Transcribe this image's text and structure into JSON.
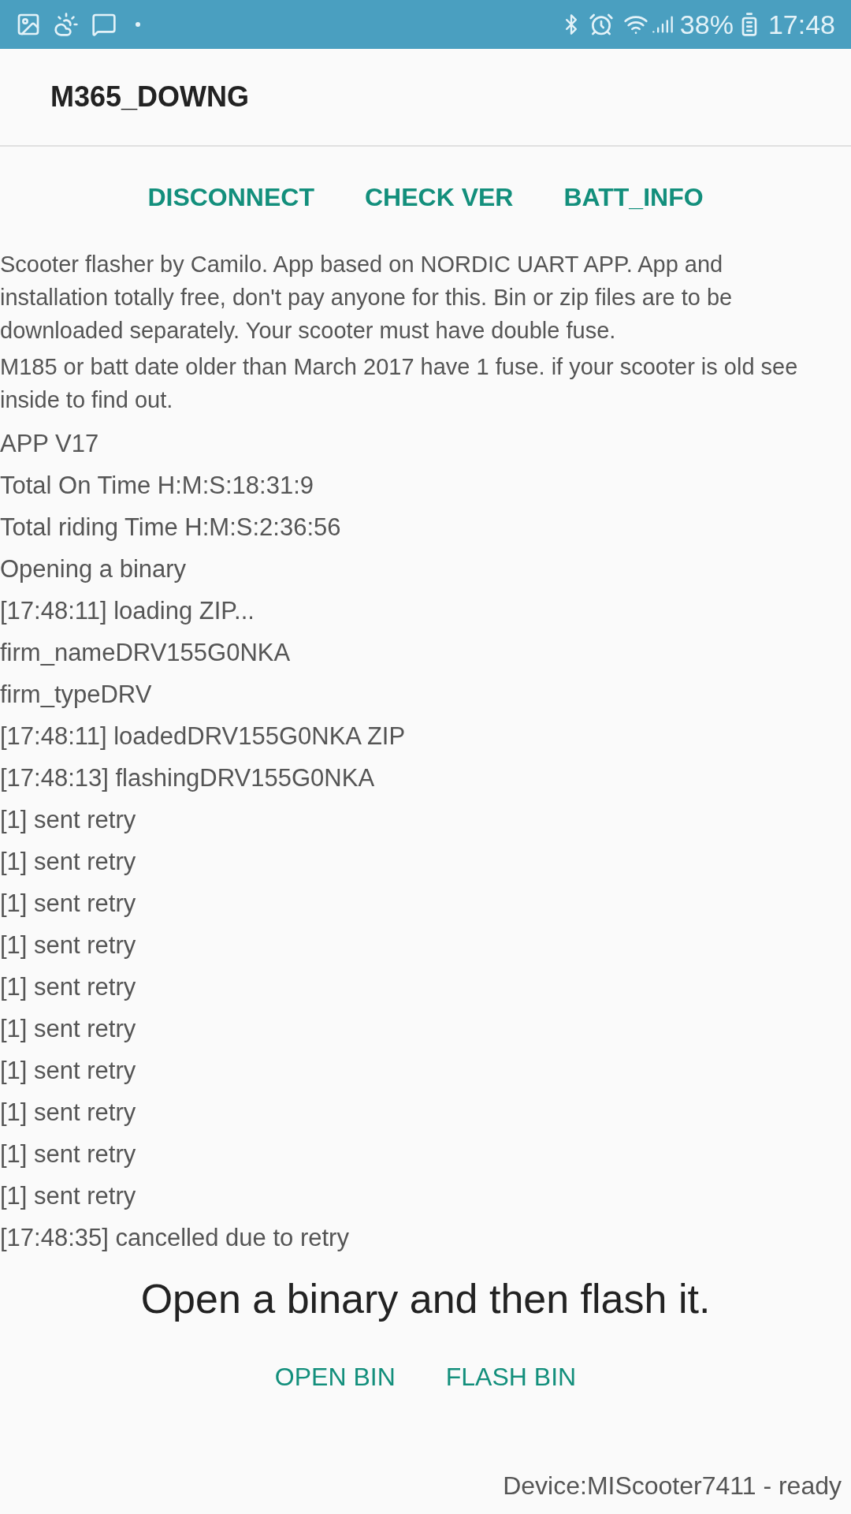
{
  "status_bar": {
    "battery": "38%",
    "time": "17:48"
  },
  "app_bar": {
    "title": "M365_DOWNG"
  },
  "top_buttons": [
    "DISCONNECT",
    "CHECK VER",
    "BATT_INFO"
  ],
  "info": [
    "Scooter flasher by Camilo. App based on NORDIC UART APP. App and installation totally free, don't pay anyone for this. Bin or zip files are to be downloaded separately. Your scooter must have double fuse.",
    "M185 or batt date older than March 2017 have 1 fuse. if your scooter is old see inside to find out."
  ],
  "log": [
    "APP V17",
    "Total On Time H:M:S:18:31:9",
    "Total riding Time H:M:S:2:36:56",
    "Opening a binary",
    "[17:48:11] loading ZIP...",
    "firm_nameDRV155G0NKA",
    "firm_typeDRV",
    "[17:48:11] loadedDRV155G0NKA ZIP",
    "[17:48:13] flashingDRV155G0NKA",
    "[1] sent retry",
    "[1] sent retry",
    "[1] sent retry",
    "[1] sent retry",
    "[1] sent retry",
    "[1] sent retry",
    "[1] sent retry",
    "[1] sent retry",
    "[1] sent retry",
    "[1] sent retry",
    "[17:48:35] cancelled due to retry"
  ],
  "instruction": "Open a binary and then flash it.",
  "bottom_buttons": [
    "OPEN BIN",
    "FLASH BIN"
  ],
  "device_status": "Device:MIScooter7411 - ready"
}
